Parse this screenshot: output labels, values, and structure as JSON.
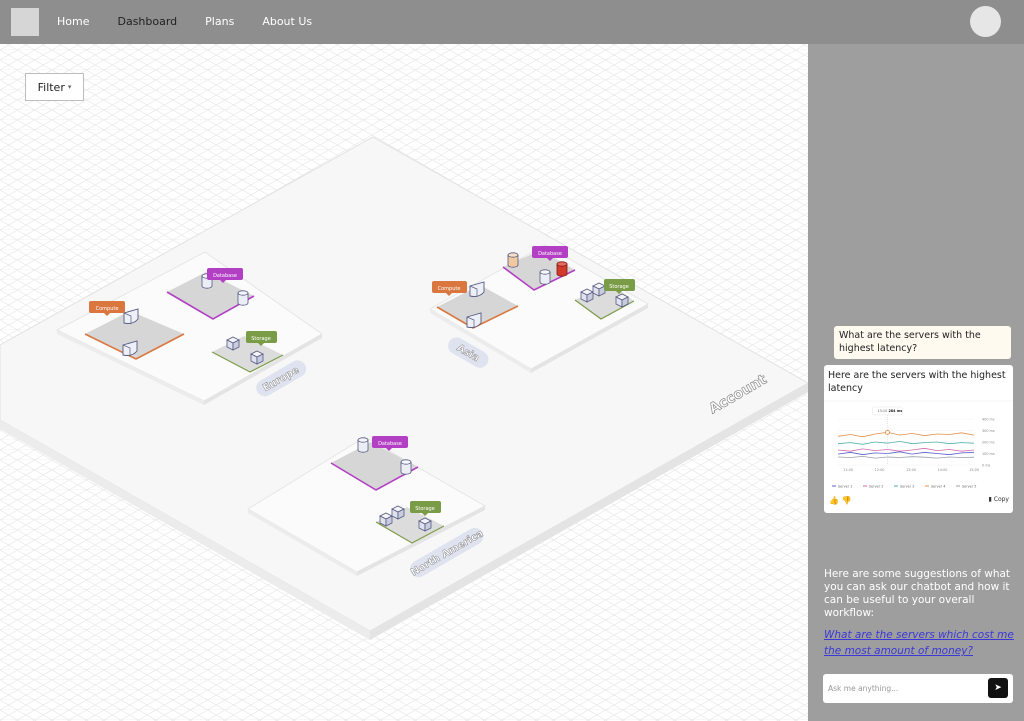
{
  "header": {
    "nav": [
      "Home",
      "Dashboard",
      "Plans",
      "About Us"
    ],
    "active": "Dashboard"
  },
  "canvas": {
    "filter_label": "Filter",
    "account_label": "Account",
    "regions": [
      {
        "name": "Europe",
        "services": [
          "Compute",
          "Database",
          "Storage"
        ]
      },
      {
        "name": "Asia",
        "services": [
          "Compute",
          "Database",
          "Storage"
        ]
      },
      {
        "name": "North America",
        "services": [
          "Database",
          "Storage"
        ]
      }
    ],
    "colors": {
      "compute": "#d9773f",
      "database": "#b23fc4",
      "storage": "#7b9c47",
      "alert": "#d33a2c",
      "region_pill": "#dfe3f0"
    }
  },
  "chat": {
    "user_message": "What are the servers with the highest latency?",
    "bot_message": "Here are the servers with the highest latency",
    "copy_label": "Copy",
    "suggestions_intro": "Here are some suggestions of what you can ask our chatbot and how it can be useful to your overall workflow:",
    "suggestion": "What are the servers which cost me the most amount of money?",
    "input_placeholder": "Ask me anything..."
  },
  "chart_data": {
    "type": "line",
    "x": [
      "11:00",
      "12:00",
      "13:00",
      "14:00",
      "15:00"
    ],
    "yticks": [
      "400 ms",
      "300 ms",
      "200 ms",
      "100 ms",
      "0 ms"
    ],
    "ylim": [
      0,
      400
    ],
    "tooltip": {
      "time": "13:10",
      "value": "284 ms"
    },
    "series": [
      {
        "name": "Server 1",
        "color": "#5a5fd1",
        "values": [
          95,
          110,
          90,
          105,
          100,
          115,
          95,
          110,
          100,
          90,
          105,
          110
        ]
      },
      {
        "name": "Server 2",
        "color": "#d06aa8",
        "values": [
          130,
          120,
          140,
          125,
          135,
          120,
          130,
          145,
          125,
          135,
          120,
          130
        ]
      },
      {
        "name": "Server 3",
        "color": "#4fb3a8",
        "values": [
          185,
          195,
          180,
          200,
          190,
          205,
          185,
          195,
          200,
          185,
          195,
          190
        ]
      },
      {
        "name": "Server 4",
        "color": "#e0904b",
        "values": [
          250,
          265,
          245,
          270,
          284,
          260,
          275,
          255,
          270,
          265,
          280,
          260
        ]
      },
      {
        "name": "Server 5",
        "color": "#9aa0a6",
        "values": [
          70,
          65,
          75,
          60,
          70,
          65,
          72,
          68,
          60,
          70,
          65,
          68
        ]
      }
    ]
  }
}
